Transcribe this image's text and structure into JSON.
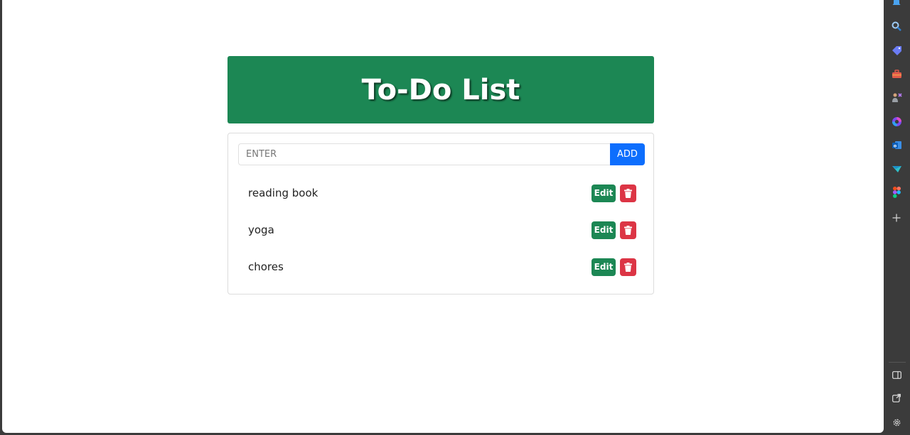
{
  "app": {
    "title": "To-Do List"
  },
  "input": {
    "placeholder": "ENTER",
    "value": ""
  },
  "add_button": {
    "label": "ADD"
  },
  "todos": [
    {
      "text": "reading book",
      "edit_label": "Edit"
    },
    {
      "text": "yoga",
      "edit_label": "Edit"
    },
    {
      "text": "chores",
      "edit_label": "Edit"
    }
  ],
  "colors": {
    "header_bg": "#1c8754",
    "add_button": "#0d6efd",
    "edit_button": "#1c8754",
    "delete_button": "#dc3545",
    "sidebar_bg": "#3b3b3b"
  },
  "sidebar": {
    "icons": [
      "bell-icon",
      "search-icon",
      "tag-icon",
      "toolbox-icon",
      "chess-icon",
      "copilot-icon",
      "outlook-icon",
      "send-icon",
      "figma-icon",
      "add-icon",
      "split-screen-icon",
      "external-link-icon",
      "settings-icon"
    ]
  }
}
